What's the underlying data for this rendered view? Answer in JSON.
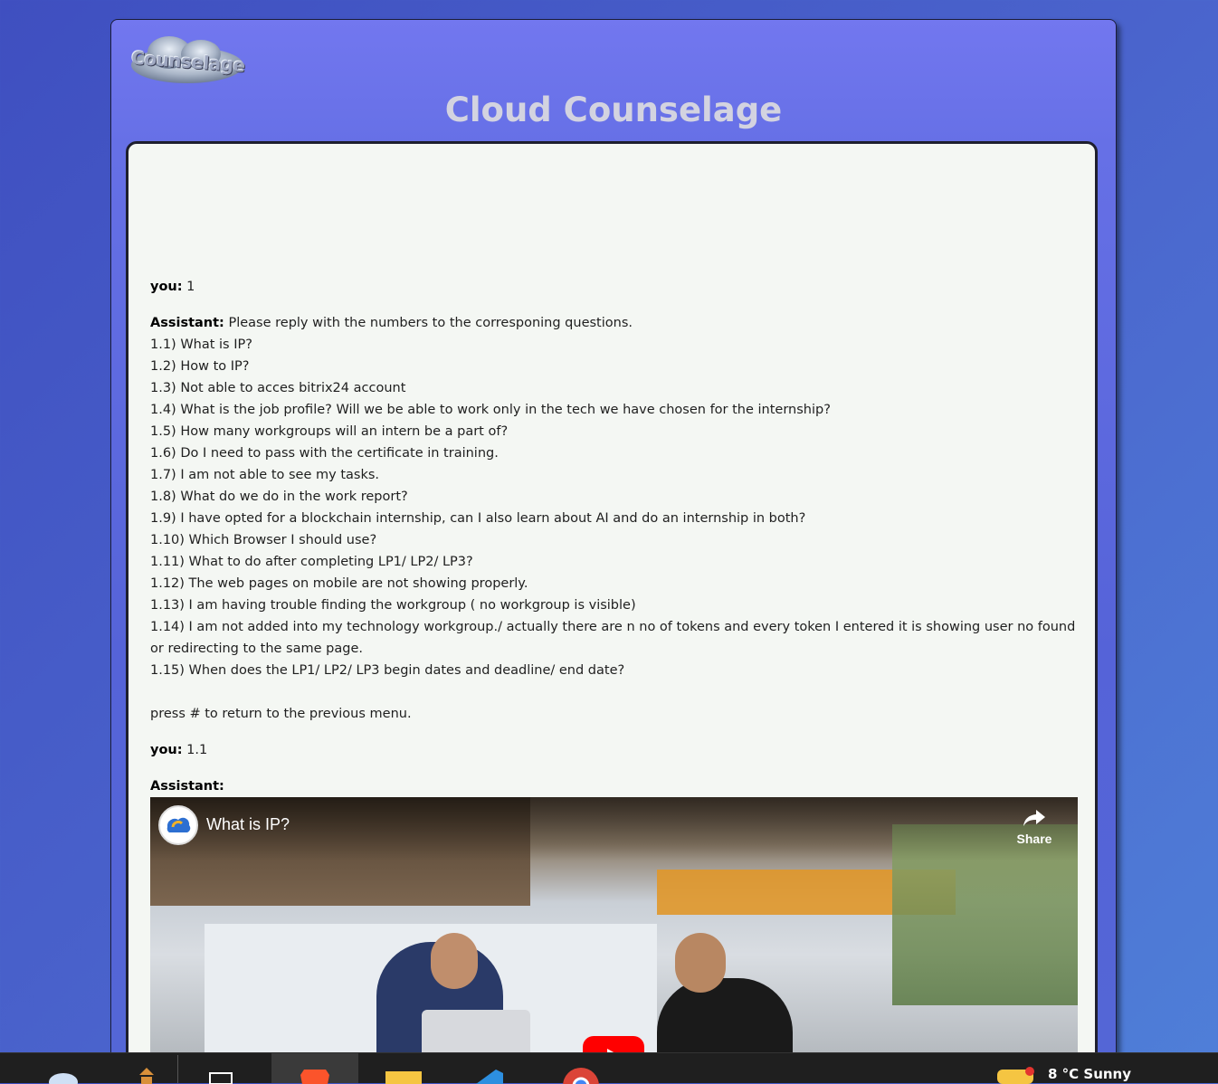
{
  "app": {
    "logo_text": "Counselage",
    "title": "Cloud Counselage"
  },
  "chat": {
    "messages": [
      {
        "role": "you:",
        "text": "1"
      },
      {
        "role": "Assistant:",
        "text": "Please reply with the numbers to the corresponing questions.",
        "lines": [
          "1.1) What is IP?",
          "1.2) How to IP?",
          "1.3) Not able to acces bitrix24 account",
          "1.4) What is the job profile? Will we be able to work only in the tech we have chosen for the internship?",
          "1.5) How many workgroups will an intern be a part of?",
          "1.6) Do I need to pass with the certificate in training.",
          "1.7) I am not able to see my tasks.",
          "1.8) What do we do in the work report?",
          "1.9) I have opted for a blockchain internship, can I also learn about AI and do an internship in both?",
          "1.10) Which Browser I should use?",
          "1.11) What to do after completing LP1/ LP2/ LP3?",
          "1.12) The web pages on mobile are not showing properly.",
          "1.13) I am having trouble finding the workgroup ( no workgroup is visible)",
          "1.14) I am not added into my technology workgroup./ actually there are n no of tokens and every token I entered it is showing user no found or redirecting to the same page.",
          "1.15) When does the LP1/ LP2/ LP3 begin dates and deadline/ end date?"
        ],
        "footer": "press # to return to the previous menu."
      },
      {
        "role": "you:",
        "text": "1.1"
      },
      {
        "role": "Assistant:",
        "text": ""
      }
    ],
    "video": {
      "title": "What is IP?",
      "share_label": "Share",
      "channel_avatar_text": "Cloud Counselage"
    }
  },
  "taskbar": {
    "partial_text": "8 °C  Sunny"
  },
  "colors": {
    "page_background": "#4a5bc8",
    "card_top": "#7277ef",
    "chat_panel": "#f4f7f3",
    "youtube_red": "#ff0000"
  }
}
